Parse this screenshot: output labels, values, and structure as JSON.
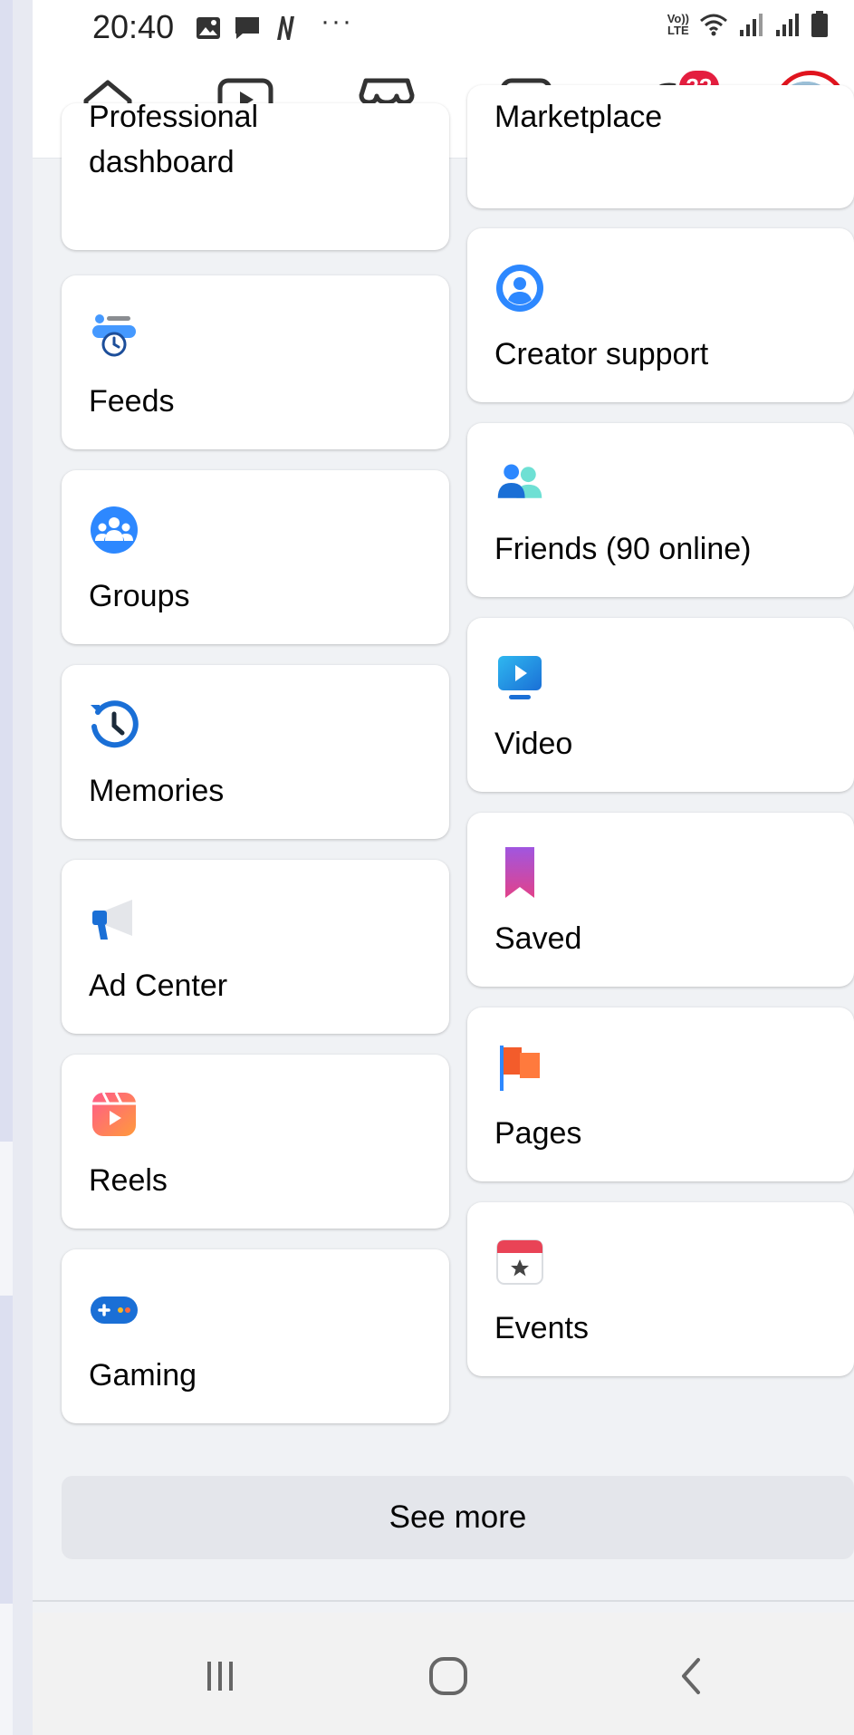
{
  "status_bar": {
    "time": "20:40",
    "volte_top": "Vo))",
    "volte_bottom": "LTE",
    "more": "···"
  },
  "top_nav": {
    "notification_count": "33",
    "items": [
      "home-icon",
      "video-icon",
      "marketplace-icon",
      "dashboard-icon",
      "bell-icon",
      "profile-avatar"
    ]
  },
  "cards_left": [
    {
      "label": "Professional",
      "label2": "dashboard",
      "icon": "none"
    },
    {
      "label": "Feeds",
      "icon": "feeds-icon"
    },
    {
      "label": "Groups",
      "icon": "groups-icon"
    },
    {
      "label": "Memories",
      "icon": "memories-icon"
    },
    {
      "label": "Ad Center",
      "icon": "megaphone-icon"
    },
    {
      "label": "Reels",
      "icon": "reels-icon"
    },
    {
      "label": "Gaming",
      "icon": "gaming-icon"
    }
  ],
  "cards_right": [
    {
      "label": "Marketplace",
      "icon": "none"
    },
    {
      "label": "Creator support",
      "icon": "creator-support-icon"
    },
    {
      "label": "Friends (90 online)",
      "icon": "friends-icon"
    },
    {
      "label": "Video",
      "icon": "video-icon"
    },
    {
      "label": "Saved",
      "icon": "bookmark-icon"
    },
    {
      "label": "Pages",
      "icon": "flag-icon"
    },
    {
      "label": "Events",
      "icon": "calendar-icon"
    }
  ],
  "see_more_label": "See more",
  "colors": {
    "accent_blue": "#1877f2",
    "badge_red": "#e41e3f",
    "highlight_red": "#e0141e",
    "background": "#f0f2f5"
  }
}
